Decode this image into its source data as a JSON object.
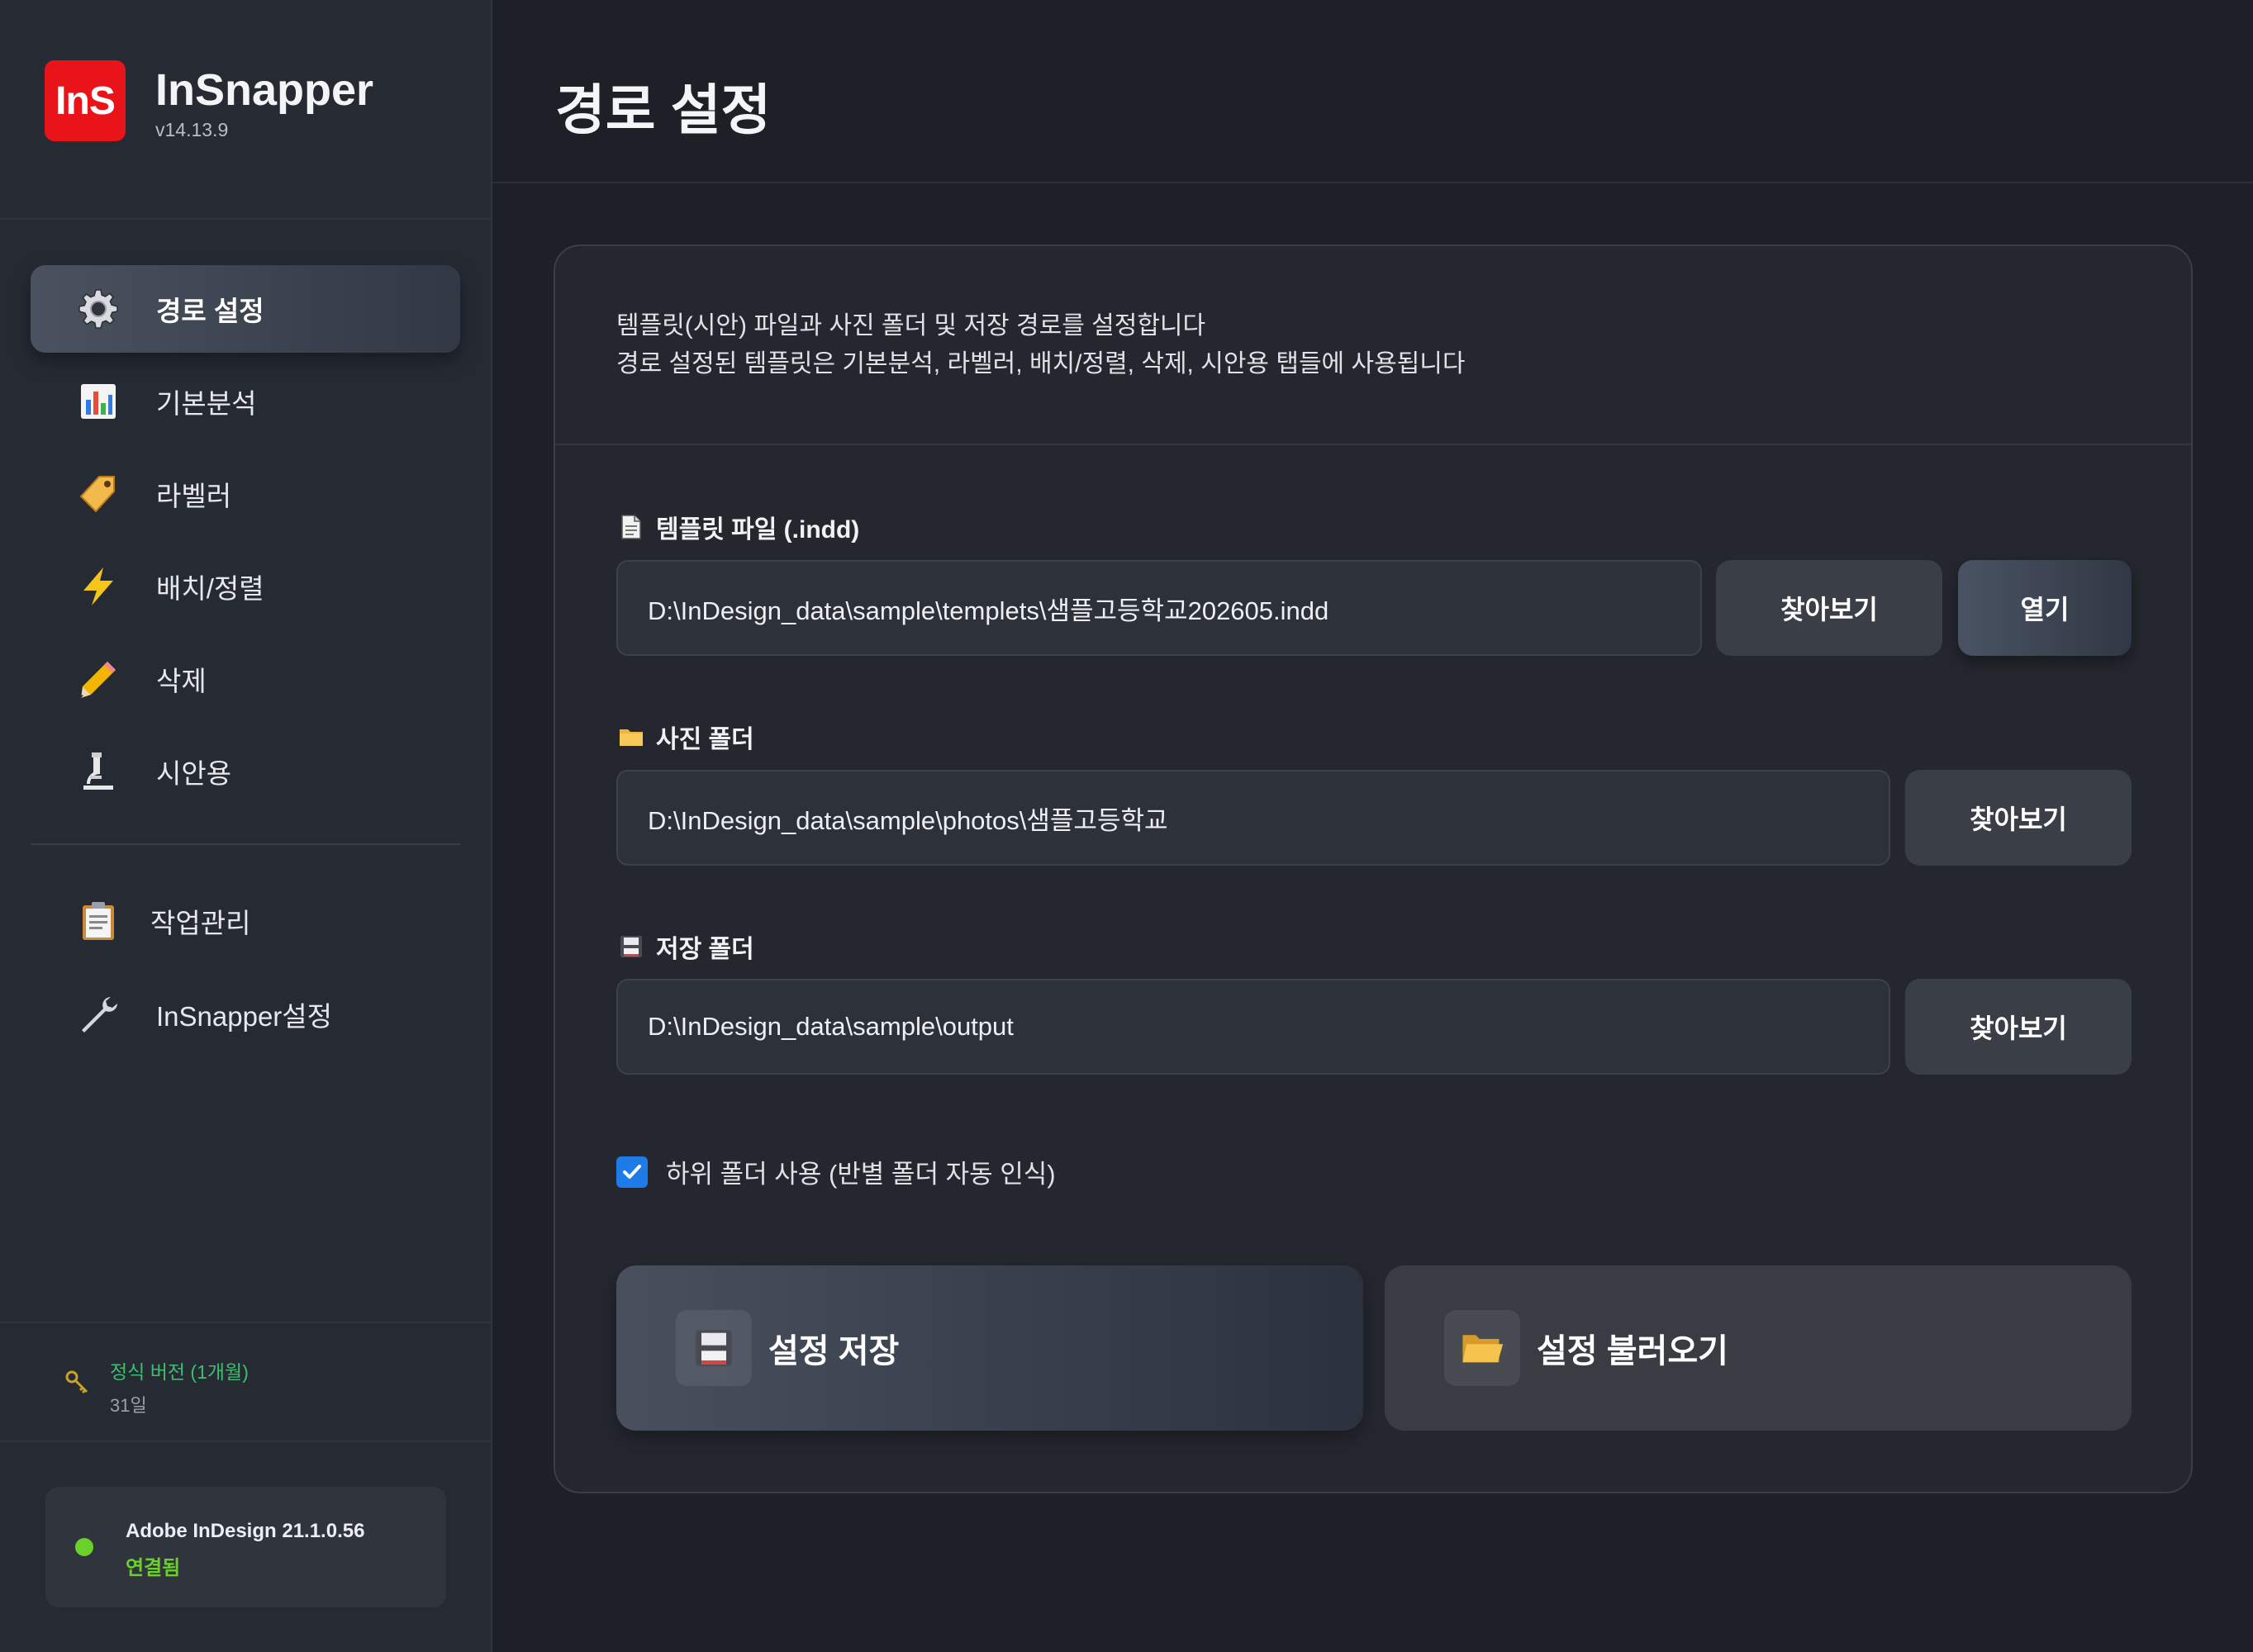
{
  "brand": {
    "logo_text": "InS",
    "name": "InSnapper",
    "version": "v14.13.9",
    "logo_color": "#e8141a"
  },
  "sidebar": {
    "items": [
      {
        "label": "경로 설정",
        "icon": "gear-icon",
        "active": true
      },
      {
        "label": "기본분석",
        "icon": "bar-chart-icon",
        "active": false
      },
      {
        "label": "라벨러",
        "icon": "tag-icon",
        "active": false
      },
      {
        "label": "배치/정렬",
        "icon": "lightning-icon",
        "active": false
      },
      {
        "label": "삭제",
        "icon": "pencil-icon",
        "active": false
      },
      {
        "label": "시안용",
        "icon": "microscope-icon",
        "active": false
      }
    ],
    "secondary_items": [
      {
        "label": "작업관리",
        "icon": "clipboard-icon"
      },
      {
        "label": "InSnapper설정",
        "icon": "wrench-icon"
      }
    ],
    "license": {
      "title": "정식 버전 (1개월)",
      "days": "31일",
      "icon": "key-icon"
    },
    "status": {
      "app": "Adobe InDesign 21.1.0.56",
      "state": "연결됨",
      "color": "#6ad02a"
    }
  },
  "page": {
    "title": "경로 설정",
    "description": [
      "템플릿(시안) 파일과 사진 폴더 및 저장 경로를 설정합니다",
      "경로 설정된 템플릿은 기본분석, 라벨러, 배치/정렬, 삭제, 시안용 탭들에 사용됩니다"
    ]
  },
  "fields": {
    "template": {
      "label": "템플릿 파일 (.indd)",
      "icon": "document-icon",
      "value": "D:\\InDesign_data\\sample\\templets\\샘플고등학교202605.indd",
      "browse_label": "찾아보기",
      "open_label": "열기"
    },
    "photos": {
      "label": "사진 폴더",
      "icon": "folder-icon",
      "value": "D:\\InDesign_data\\sample\\photos\\샘플고등학교",
      "browse_label": "찾아보기"
    },
    "output": {
      "label": "저장 폴더",
      "icon": "floppy-icon",
      "value": "D:\\InDesign_data\\sample\\output",
      "browse_label": "찾아보기"
    }
  },
  "options": {
    "subfolders_label": "하위 폴더 사용 (반별 폴더 자동 인식)",
    "subfolders_checked": true
  },
  "actions": {
    "save_label": "설정 저장",
    "save_icon": "floppy-icon",
    "load_label": "설정 불러오기",
    "load_icon": "open-folder-icon"
  },
  "colors": {
    "accent_checkbox": "#1f7be8",
    "license_green": "#3cbf6f"
  }
}
